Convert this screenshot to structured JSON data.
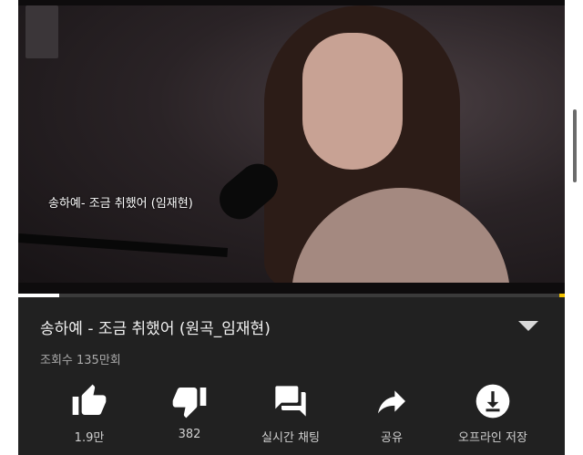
{
  "video": {
    "caption": "송하예- 조금 취했어 (임재현)",
    "progress": 0.075
  },
  "info": {
    "title": "송하예 - 조금 취했어 (원곡_임재현)",
    "views": "조회수 135만회"
  },
  "actions": [
    {
      "label": "1.9만",
      "icon": "thumbs-up-icon"
    },
    {
      "label": "382",
      "icon": "thumbs-down-icon"
    },
    {
      "label": "실시간 채팅",
      "icon": "live-chat-icon"
    },
    {
      "label": "공유",
      "icon": "share-icon"
    },
    {
      "label": "오프라인 저장",
      "icon": "download-icon"
    }
  ],
  "colors": {
    "background": "#212121",
    "text": "#f1f1f1",
    "secondary_text": "#aaaaaa",
    "ad_marker": "#f2c200"
  }
}
